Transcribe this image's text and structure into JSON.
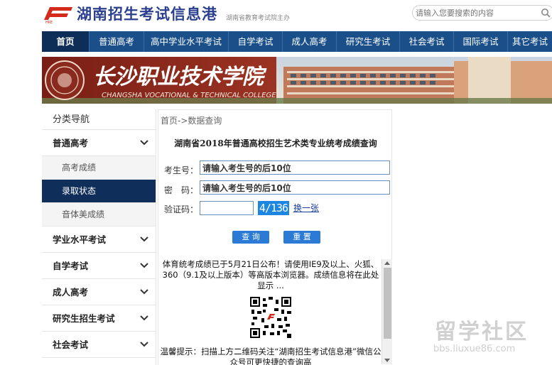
{
  "header": {
    "site_title": "湖南招生考试信息港",
    "site_subtitle": "湖南省教育考试院主办",
    "search_placeholder": "请输入您要搜索的内容",
    "brand_color": "#2b3f8f",
    "logo_icon": "hnzk-logo-icon",
    "search_icon": "search-icon"
  },
  "nav": {
    "items": [
      {
        "label": "首页",
        "active": true
      },
      {
        "label": "普通高考"
      },
      {
        "label": "高中学业水平考试"
      },
      {
        "label": "自学考试"
      },
      {
        "label": "成人高考"
      },
      {
        "label": "研究生考试"
      },
      {
        "label": "社会考试"
      },
      {
        "label": "国际考试"
      },
      {
        "label": "其它考试"
      }
    ],
    "bg_color": "#1a4f8a"
  },
  "banner": {
    "school_name_cn": "长沙职业技术学院",
    "school_name_en": "CHANGSHA VOCATIONAL & TECHNICAL COLLEGE"
  },
  "sidebar": {
    "title": "分类导航",
    "groups": [
      {
        "label": "普通高考",
        "expanded": true,
        "sub": [
          {
            "label": "高考成绩"
          },
          {
            "label": "录取状态",
            "active": true
          },
          {
            "label": "音体美成绩"
          }
        ]
      },
      {
        "label": "学业水平考试"
      },
      {
        "label": "自学考试"
      },
      {
        "label": "成人高考"
      },
      {
        "label": "研究生招生考试"
      },
      {
        "label": "社会考试"
      }
    ]
  },
  "main": {
    "breadcrumb": "首页->数据查询",
    "form_title": "湖南省2018年普通高校招生艺术类专业统考成绩查询",
    "exam_no_label": "考生号：",
    "exam_no_value": "请输入考生号的后10位",
    "password_label": "密　码：",
    "password_value": "请输入考生号的后10位",
    "captcha_label": "验证码：",
    "captcha_text": "4/136",
    "refresh_link": "换一张",
    "query_button": "查 询",
    "reset_button": "重 置",
    "notice_text": "体育统考成绩已于5月21日公布！请使用IE9及以上、火狐、360（9.1及以上版本）等高版本浏览器。成绩信息将在此处显示 ...",
    "tip_text": "温馨提示：扫描上方二维码关注“湖南招生考试信息港”微信公众号可更快捷的查询高",
    "button_color": "#2a7ad6"
  },
  "watermark": {
    "text": "留学社区",
    "url": "bbs.liuxue86.com"
  }
}
